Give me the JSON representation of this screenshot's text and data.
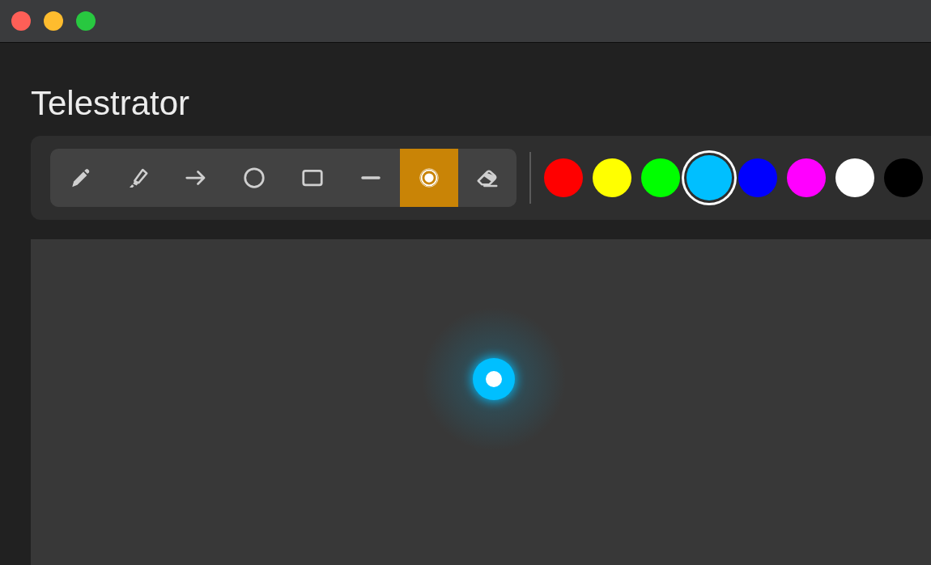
{
  "title": "Telestrator",
  "tools": [
    {
      "kind": "pen",
      "selected": false
    },
    {
      "kind": "highlighter",
      "selected": false
    },
    {
      "kind": "arrow",
      "selected": false
    },
    {
      "kind": "circle",
      "selected": false
    },
    {
      "kind": "rectangle",
      "selected": false
    },
    {
      "kind": "line",
      "selected": false
    },
    {
      "kind": "laser",
      "selected": true
    },
    {
      "kind": "eraser",
      "selected": false
    }
  ],
  "swatches": [
    {
      "color": "#ff0000",
      "selected": false
    },
    {
      "color": "#ffff00",
      "selected": false
    },
    {
      "color": "#00ff00",
      "selected": false
    },
    {
      "color": "#00bfff",
      "selected": true
    },
    {
      "color": "#0000ff",
      "selected": false
    },
    {
      "color": "#ff00ff",
      "selected": false
    },
    {
      "color": "#ffffff",
      "selected": false
    },
    {
      "color": "#000000",
      "selected": false
    }
  ]
}
